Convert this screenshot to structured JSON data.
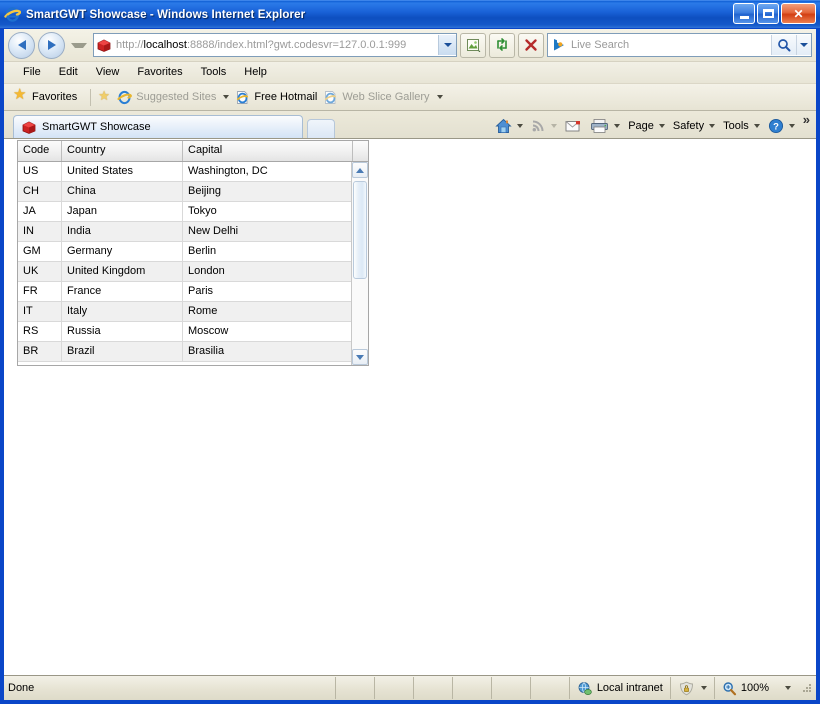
{
  "window": {
    "title": "SmartGWT Showcase - Windows Internet Explorer",
    "minimize_label": "Minimize",
    "maximize_label": "Maximize",
    "close_label": "Close"
  },
  "nav": {
    "back_label": "Back",
    "forward_label": "Forward",
    "recent_pages_label": "Recent Pages",
    "address": {
      "scheme": "http://",
      "host": "localhost",
      "path": ":8888/index.html?gwt.codesvr=127.0.0.1:999",
      "full": "http://localhost:8888/index.html?gwt.codesvr=127.0.0.1:999"
    },
    "compat_view_label": "Compatibility View",
    "refresh_label": "Refresh",
    "stop_label": "Stop",
    "search": {
      "placeholder": "Live Search",
      "provider": "bing-icon",
      "go_label": "Search"
    }
  },
  "menu": {
    "items": [
      {
        "label": "File"
      },
      {
        "label": "Edit"
      },
      {
        "label": "View"
      },
      {
        "label": "Favorites"
      },
      {
        "label": "Tools"
      },
      {
        "label": "Help"
      }
    ]
  },
  "favorites_bar": {
    "favorites_label": "Favorites",
    "items": [
      {
        "label": "Suggested Sites",
        "icon": "ie-icon",
        "dimmed": true,
        "has_caret": true
      },
      {
        "label": "Free Hotmail",
        "icon": "ie-page-icon",
        "dimmed": false,
        "has_caret": false
      },
      {
        "label": "Web Slice Gallery",
        "icon": "ie-page-icon",
        "dimmed": true,
        "has_caret": true
      }
    ]
  },
  "tabs": {
    "items": [
      {
        "label": "SmartGWT Showcase",
        "icon": "smartgwt-icon",
        "active": true
      }
    ],
    "new_tab_label": "New Tab"
  },
  "command_bar": {
    "home_label": "Home",
    "feeds_label": "Feeds",
    "mail_label": "Read Mail",
    "print_label": "Print",
    "items": [
      {
        "label": "Page"
      },
      {
        "label": "Safety"
      },
      {
        "label": "Tools"
      }
    ],
    "help_label": "Help",
    "overflow_label": "»"
  },
  "grid": {
    "columns": [
      {
        "key": "code",
        "label": "Code"
      },
      {
        "key": "country",
        "label": "Country"
      },
      {
        "key": "capital",
        "label": "Capital"
      }
    ],
    "rows": [
      {
        "code": "US",
        "country": "United States",
        "capital": "Washington, DC"
      },
      {
        "code": "CH",
        "country": "China",
        "capital": "Beijing"
      },
      {
        "code": "JA",
        "country": "Japan",
        "capital": "Tokyo"
      },
      {
        "code": "IN",
        "country": "India",
        "capital": "New Delhi"
      },
      {
        "code": "GM",
        "country": "Germany",
        "capital": "Berlin"
      },
      {
        "code": "UK",
        "country": "United Kingdom",
        "capital": "London"
      },
      {
        "code": "FR",
        "country": "France",
        "capital": "Paris"
      },
      {
        "code": "IT",
        "country": "Italy",
        "capital": "Rome"
      },
      {
        "code": "RS",
        "country": "Russia",
        "capital": "Moscow"
      },
      {
        "code": "BR",
        "country": "Brazil",
        "capital": "Brasilia"
      }
    ],
    "scrollbar": {
      "up_label": "Scroll up",
      "down_label": "Scroll down",
      "thumb_top_pct": 2,
      "thumb_height_pct": 56
    }
  },
  "status_bar": {
    "status_text": "Done",
    "zone_label": "Local intranet",
    "protected_mode_label": "Protected Mode",
    "zoom_level": "100%"
  },
  "colors": {
    "title_bar": "#0a46c8",
    "chrome": "#ece9d8",
    "content_bg": "#ffffff",
    "grid_border": "#a7a7a7",
    "grid_row_alt": "#f0f0f0",
    "accent_blue": "#2f6fbf"
  }
}
